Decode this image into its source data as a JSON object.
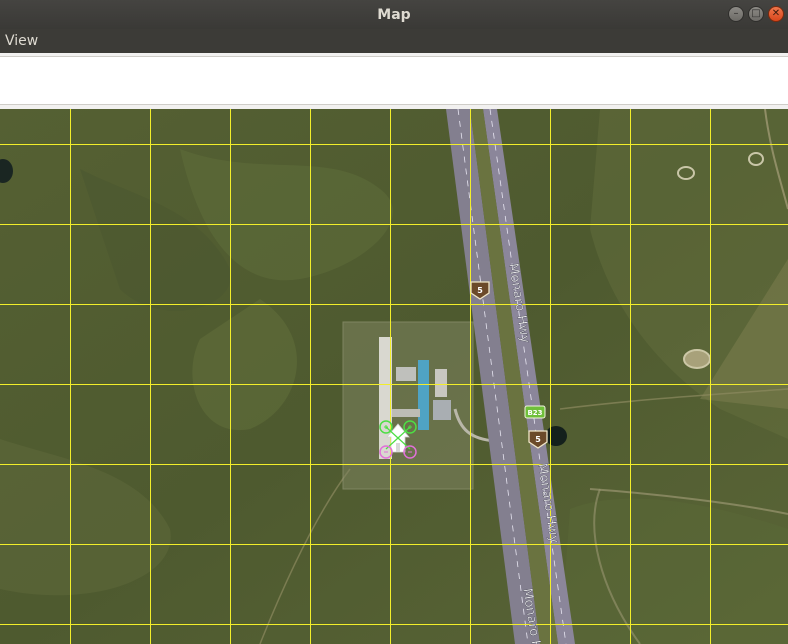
{
  "window": {
    "title": "Map",
    "controls": {
      "minimize": "–",
      "maximize": "□",
      "close": "✕"
    }
  },
  "menu": {
    "items": [
      "View"
    ]
  },
  "map": {
    "roads": [
      {
        "label": "Monaro Hwy",
        "shield": "5"
      },
      {
        "label": "Monaro Hwy",
        "shield": "5"
      },
      {
        "label": "Monaro H"
      }
    ],
    "route_badge": "B23",
    "markers": {
      "home": "home-icon",
      "vehicle": "quadcopter-icon"
    },
    "colors": {
      "grid": "#f2ee2a",
      "road": "#8f8aa3",
      "vehicle_front": "#4dde45",
      "vehicle_rear": "#e070d8",
      "shield": "#6b4a2a",
      "badge": "#6fbf3a"
    }
  }
}
